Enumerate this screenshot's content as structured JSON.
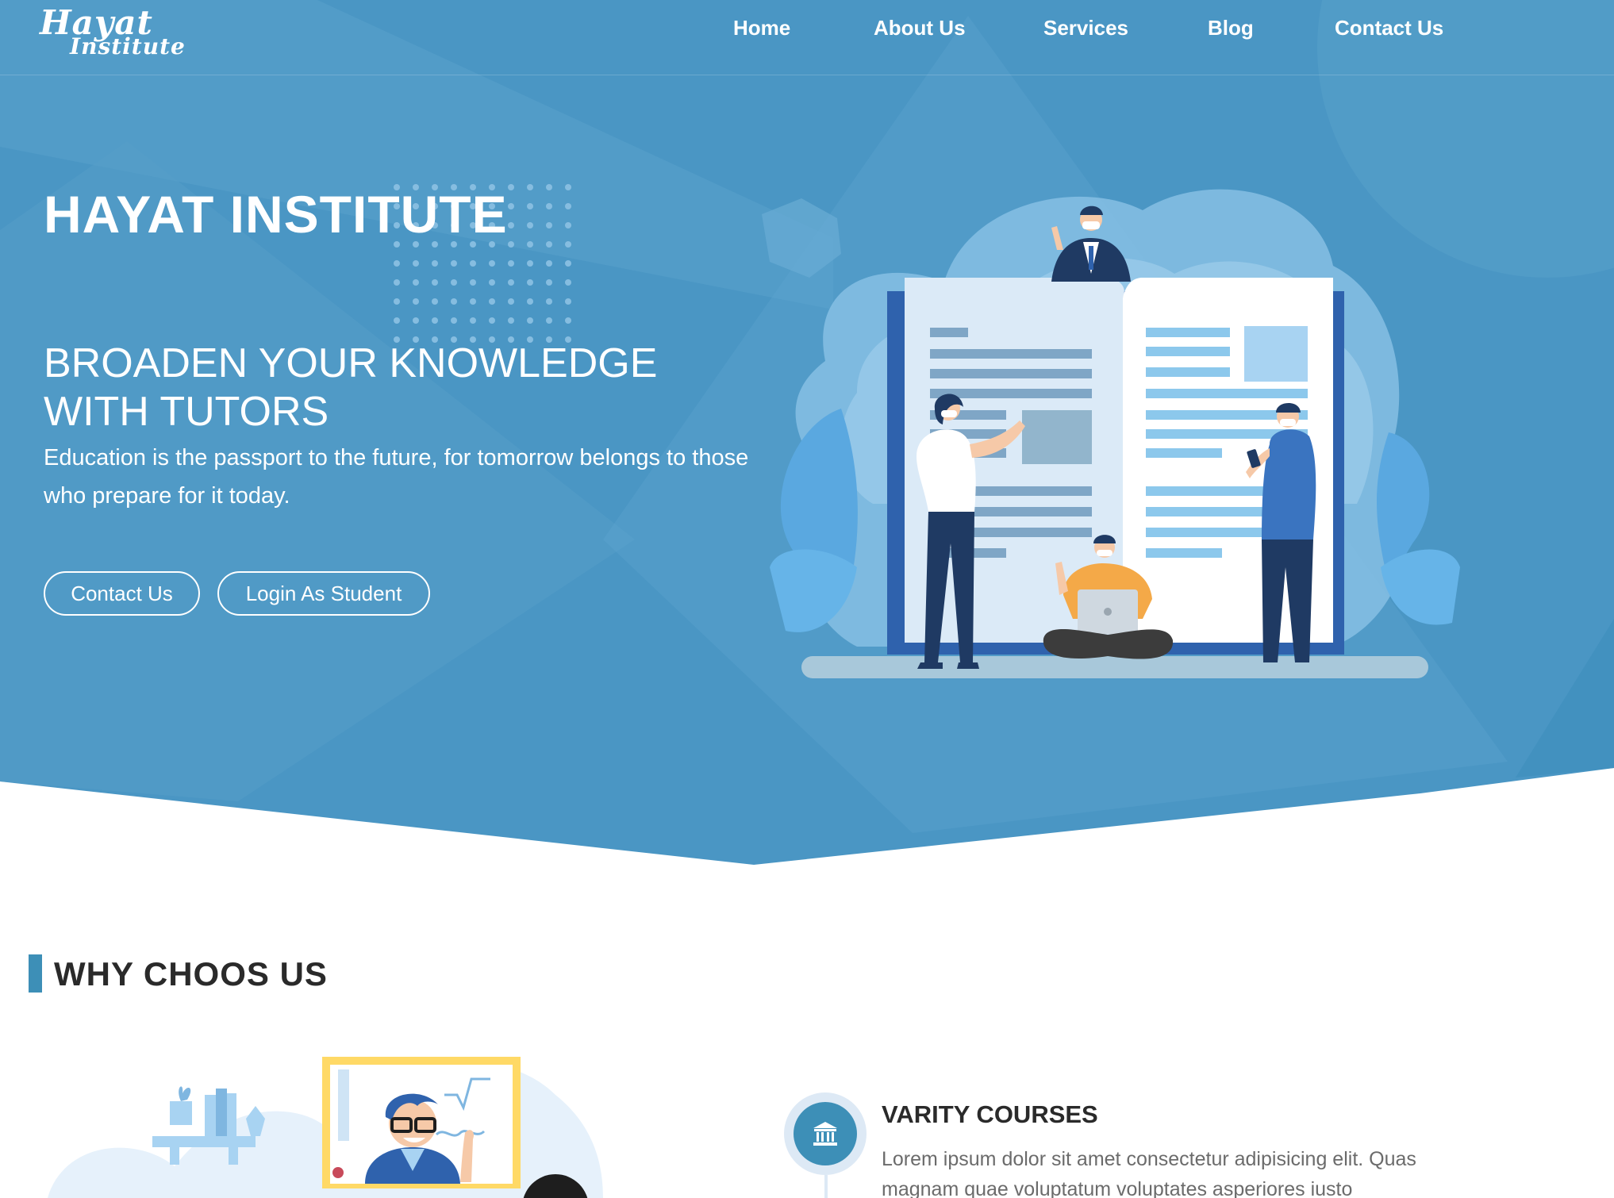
{
  "brand": {
    "logo_main": "Hayat",
    "logo_sub": "Institute"
  },
  "nav": {
    "items": [
      {
        "label": "Home"
      },
      {
        "label": "About Us"
      },
      {
        "label": "Services"
      },
      {
        "label": "Blog"
      },
      {
        "label": "Contact Us"
      }
    ]
  },
  "hero": {
    "title": "HAYAT INSTITUTE",
    "tagline_line1": "BROADEN YOUR KNOWLEDGE",
    "tagline_line2": "WITH TUTORS",
    "quote": "Education is the passport to the future, for tomorrow belongs to those who prepare for it today.",
    "buttons": {
      "contact": "Contact Us",
      "login": "Login As Student"
    }
  },
  "why": {
    "title": "WHY CHOOS US",
    "features": [
      {
        "icon": "bank-icon",
        "title": "VARITY COURSES",
        "text": "Lorem ipsum dolor sit amet consectetur adipisicing elit. Quas magnam quae voluptatum voluptates asperiores iusto"
      }
    ]
  },
  "colors": {
    "hero_bg": "#4a96c4",
    "accent": "#3d8fb7",
    "heading": "#2a2a2a",
    "body_text": "#6b6b6b"
  }
}
